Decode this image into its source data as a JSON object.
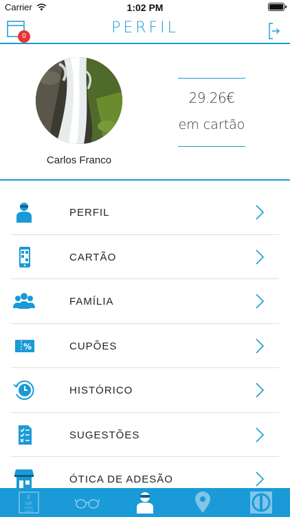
{
  "status_bar": {
    "carrier": "Carrier",
    "time": "1:02 PM"
  },
  "header": {
    "title": "PERFIL",
    "notification_count": "0"
  },
  "profile": {
    "user_name": "Carlos Franco",
    "balance_amount": "29.26€",
    "balance_label": "em cartão"
  },
  "menu": {
    "items": [
      {
        "label": "PERFIL",
        "icon": "person-icon"
      },
      {
        "label": "CARTÃO",
        "icon": "phone-card-icon"
      },
      {
        "label": "FAMÍLIA",
        "icon": "family-icon"
      },
      {
        "label": "CUPÕES",
        "icon": "coupon-icon"
      },
      {
        "label": "HISTÓRICO",
        "icon": "history-clock-icon"
      },
      {
        "label": "SUGESTÕES",
        "icon": "suggestions-doc-icon"
      },
      {
        "label": "ÓTICA DE ADESÃO",
        "icon": "store-icon"
      }
    ]
  },
  "tab_bar": {
    "tabs": [
      "eye-chart-icon",
      "glasses-icon",
      "person-icon",
      "location-pin-icon",
      "brand-logo-icon"
    ],
    "active_index": 2
  },
  "colors": {
    "accent": "#1a9ad6",
    "badge": "#e43535",
    "tab_inactive": "#7fc6ea"
  }
}
